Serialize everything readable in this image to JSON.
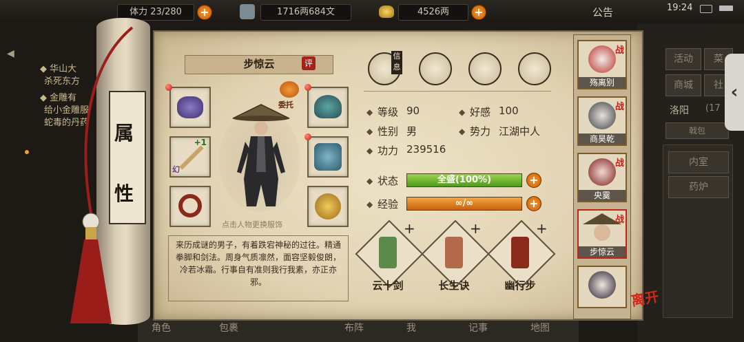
{
  "status_bar": {
    "time": "19:24"
  },
  "top": {
    "stamina": "体力 23/280",
    "money_text": "1716两684文",
    "gold": "4526两",
    "notice": "公告"
  },
  "left_quest": [
    {
      "title": "◆ 华山大",
      "body": "杀死东方"
    },
    {
      "title": "◆ 金雕有",
      "body": "给小金雕服"
    },
    {
      "title": "",
      "body": "蛇毒的丹药"
    }
  ],
  "right_menu": {
    "buttons": [
      "活动",
      "菜",
      "商城",
      "社"
    ],
    "location": "洛阳",
    "location_extra": "(17",
    "tab": "戟包",
    "list": [
      "内室",
      "药炉"
    ]
  },
  "scroll_label": [
    "属",
    "性"
  ],
  "character": {
    "name": "步惊云",
    "rate_badge": "评",
    "change_hint": "点击人物更换服饰",
    "delegate": "委托",
    "equip_plus": "+1",
    "equip_tag": "幻",
    "description": "来历成谜的男子，有着跌宕神秘的过往。精通拳脚和剑法。周身气质凛然，面容坚毅俊朗，冷若冰霜。行事自有准则我行我素，亦正亦邪。"
  },
  "tabs": [
    {
      "name": "信息",
      "icon": "info-hat-icon"
    },
    {
      "name": "",
      "icon": "scroll-icon"
    },
    {
      "name": "",
      "icon": "yinyang-icon"
    },
    {
      "name": "",
      "icon": "meridian-icon"
    }
  ],
  "stats": {
    "level_label": "等级",
    "level": "90",
    "favor_label": "好感",
    "favor": "100",
    "gender_label": "性别",
    "gender": "男",
    "faction_label": "势力",
    "faction": "江湖中人",
    "power_label": "功力",
    "power": "239516",
    "state_label": "状态",
    "state_text": "全盛(100%)",
    "state_ratio": 1.0,
    "exp_label": "经验",
    "exp_text": "∞/∞",
    "exp_ratio": 1.0
  },
  "skills": [
    {
      "name": "云十剑"
    },
    {
      "name": "长生诀"
    },
    {
      "name": "幽行步"
    }
  ],
  "heroes": [
    {
      "name": "殇离别",
      "tag": "战"
    },
    {
      "name": "商昊乾",
      "tag": "战"
    },
    {
      "name": "央霙",
      "tag": "战"
    },
    {
      "name": "步惊云",
      "tag": "战"
    },
    {
      "name": "",
      "tag": ""
    }
  ],
  "leave": "离开",
  "bottom_menu": [
    "角色",
    "包裹",
    "布阵",
    "我",
    "记事",
    "地图"
  ],
  "colors": {
    "state_bar": "#6fbf2a",
    "exp_bar": "#e8841c",
    "accent_red": "#b3241a"
  }
}
